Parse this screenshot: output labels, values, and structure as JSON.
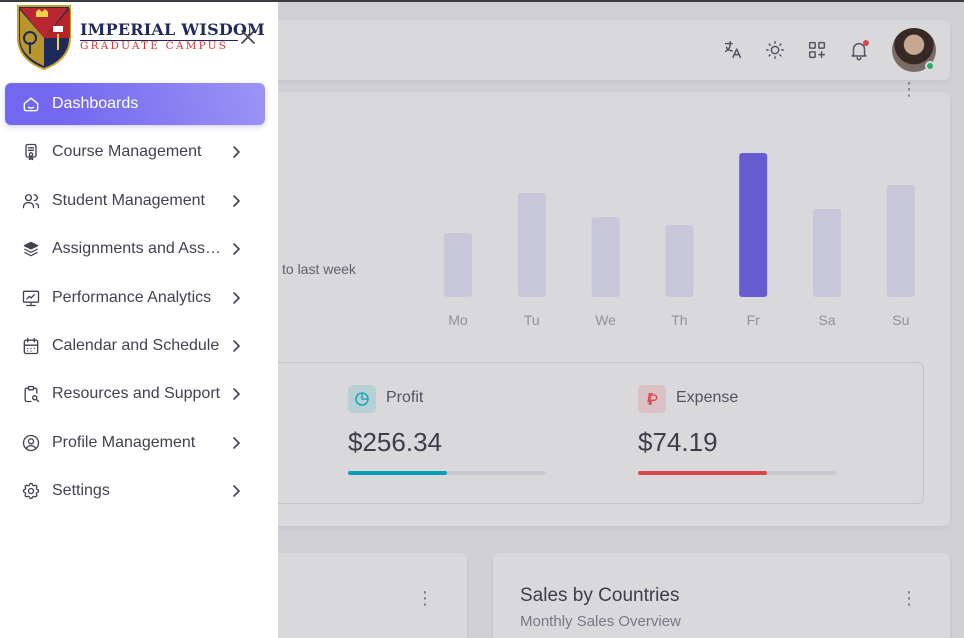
{
  "brand": {
    "name_line1": "IMPERIAL WISDOM",
    "name_line2": "GRADUATE CAMPUS"
  },
  "sidebar": {
    "items": [
      {
        "label": "Dashboards",
        "icon": "home-icon",
        "active": true
      },
      {
        "label": "Course Management",
        "icon": "certificate-icon"
      },
      {
        "label": "Student Management",
        "icon": "users-icon"
      },
      {
        "label": "Assignments and Assessments",
        "icon": "stack-icon"
      },
      {
        "label": "Performance Analytics",
        "icon": "chart-line-icon"
      },
      {
        "label": "Calendar and Schedule",
        "icon": "calendar-icon"
      },
      {
        "label": "Resources and Support",
        "icon": "clipboard-search-icon"
      },
      {
        "label": "Profile Management",
        "icon": "user-circle-icon"
      },
      {
        "label": "Settings",
        "icon": "settings-icon"
      }
    ]
  },
  "navbar": {
    "icons": [
      "translate-icon",
      "sun-icon",
      "apps-add-icon",
      "bell-icon"
    ]
  },
  "dashboard": {
    "comparison_text": "to last week",
    "stats": [
      {
        "label": "Profit",
        "value": "$256.34",
        "progress": 0.5,
        "color": "#00bad1"
      },
      {
        "label": "Expense",
        "value": "$74.19",
        "progress": 0.65,
        "color": "#ff4c51"
      }
    ]
  },
  "sales_by_countries": {
    "title": "Sales by Countries",
    "subtitle": "Monthly Sales Overview"
  },
  "chart_data": {
    "type": "bar",
    "categories": [
      "Mo",
      "Tu",
      "We",
      "Th",
      "Fr",
      "Sa",
      "Su"
    ],
    "values": [
      40,
      65,
      50,
      45,
      90,
      55,
      70
    ],
    "highlight": "Fr",
    "ylim": [
      0,
      100
    ],
    "grid": false
  }
}
